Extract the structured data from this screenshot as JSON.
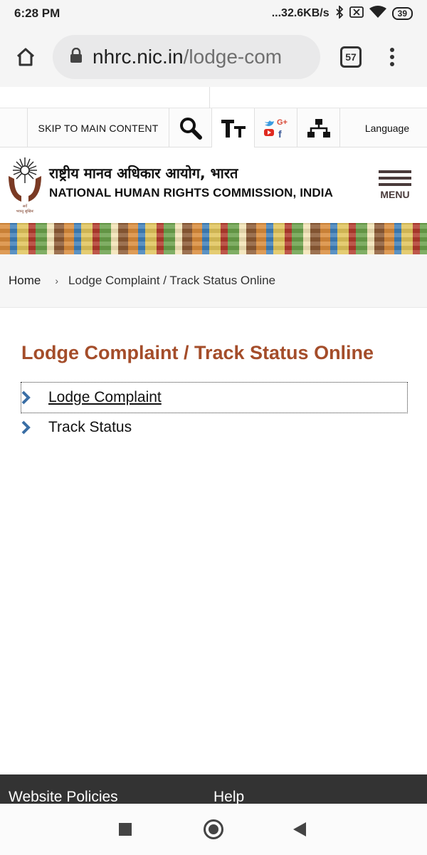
{
  "status_bar": {
    "time": "6:28 PM",
    "network_speed": "...32.6KB/s",
    "battery": "39"
  },
  "browser": {
    "url_host": "nhrc.nic.in",
    "url_path": "/lodge-com",
    "tab_count": "57"
  },
  "accessibility_bar": {
    "skip_label": "SKIP TO MAIN CONTENT",
    "language_label": "Language"
  },
  "header": {
    "title_hindi": "राष्ट्रीय मानव अधिकार आयोग, भारत",
    "title_english": "NATIONAL HUMAN RIGHTS COMMISSION, INDIA",
    "menu_label": "MENU"
  },
  "breadcrumb": {
    "home": "Home",
    "separator": "›",
    "current": "Lodge Complaint / Track Status Online"
  },
  "main": {
    "title": "Lodge Complaint / Track Status Online",
    "links": [
      {
        "label": "Lodge Complaint"
      },
      {
        "label": "Track Status"
      }
    ]
  },
  "footer": {
    "website_policies": "Website Policies",
    "help": "Help"
  },
  "colors": {
    "title_color": "#a44d2a",
    "chevron_color": "#3a6ea5",
    "footer_bg": "#333333"
  }
}
